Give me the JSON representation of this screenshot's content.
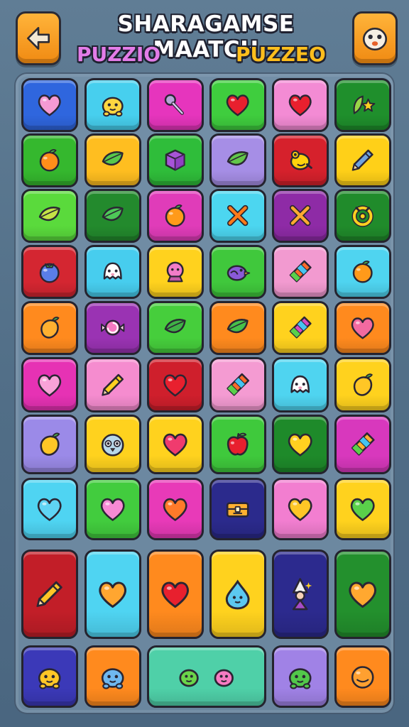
{
  "header": {
    "title": "SHARAGAMSE MAATCH",
    "subtitle_left": "PUZZIO",
    "subtitle_right": "PUZZEO",
    "back_icon": "back-arrow-icon",
    "profile_icon": "cartoon-face-icon"
  },
  "board": {
    "rows": [
      [
        {
          "color": "#2f66de",
          "icon": "heart-icon",
          "accent": "#f59ad4"
        },
        {
          "color": "#47cfee",
          "icon": "face-icon",
          "accent": "#ffd640"
        },
        {
          "color": "#e635bd",
          "icon": "wand-icon",
          "accent": "#b7a4d9"
        },
        {
          "color": "#3fcd3e",
          "icon": "heart-icon",
          "accent": "#e8202e"
        },
        {
          "color": "#f38bd4",
          "icon": "heart-icon",
          "accent": "#e8202e"
        },
        {
          "color": "#1f8f2c",
          "icon": "leaf-star-icon",
          "accent": "#9bd448"
        }
      ],
      [
        {
          "color": "#35b82e",
          "icon": "orange-icon",
          "accent": "#ff8e1a"
        },
        {
          "color": "#ffbe20",
          "icon": "leaf-icon",
          "accent": "#58c84c"
        },
        {
          "color": "#2fbd3a",
          "icon": "cube-icon",
          "accent": "#a754d8"
        },
        {
          "color": "#a68ee6",
          "icon": "leaf-icon",
          "accent": "#62c64a"
        },
        {
          "color": "#d6212c",
          "icon": "blob-creature-icon",
          "accent": "#ffd20c"
        },
        {
          "color": "#ffd018",
          "icon": "pen-icon",
          "accent": "#6fa3e0"
        }
      ],
      [
        {
          "color": "#5ada3c",
          "icon": "leaf-icon",
          "accent": "#c4e246"
        },
        {
          "color": "#238a2d",
          "icon": "leaf-icon",
          "accent": "#4ec858"
        },
        {
          "color": "#e03cb9",
          "icon": "orange-icon",
          "accent": "#ff9a1a"
        },
        {
          "color": "#4cd6f0",
          "icon": "cross-icon",
          "accent": "#ff7a1a"
        },
        {
          "color": "#8e2ba6",
          "icon": "cross-icon",
          "accent": "#ffaa30"
        },
        {
          "color": "#208b2b",
          "icon": "ring-icon",
          "accent": "#ffd020"
        }
      ],
      [
        {
          "color": "#d42631",
          "icon": "berry-icon",
          "accent": "#5a7ee8"
        },
        {
          "color": "#47cdee",
          "icon": "ghost-icon",
          "accent": "#ffffff"
        },
        {
          "color": "#ffd21e",
          "icon": "globe-creature-icon",
          "accent": "#f27cc8"
        },
        {
          "color": "#40c83c",
          "icon": "bird-icon",
          "accent": "#8a5ad8"
        },
        {
          "color": "#f29ad0",
          "icon": "crayon-icon",
          "accent": "#ff6a2a"
        },
        {
          "color": "#4fd4f0",
          "icon": "orange-icon",
          "accent": "#ff9a1a"
        }
      ],
      [
        {
          "color": "#ff8a1e",
          "icon": "mango-icon",
          "accent": "#ffb030"
        },
        {
          "color": "#9a33b3",
          "icon": "candy-icon",
          "accent": "#f77ac2"
        },
        {
          "color": "#46ce3c",
          "icon": "leaf-icon",
          "accent": "#3fb046"
        },
        {
          "color": "#ff8a1e",
          "icon": "leaf-icon",
          "accent": "#46c04a"
        },
        {
          "color": "#ffd21e",
          "icon": "crayon-icon",
          "accent": "#d64bc0"
        },
        {
          "color": "#ff8a1e",
          "icon": "heart-icon",
          "accent": "#f26aa0"
        }
      ],
      [
        {
          "color": "#e632b4",
          "icon": "heart-icon",
          "accent": "#f9a2d8"
        },
        {
          "color": "#f58ccf",
          "icon": "pen-icon",
          "accent": "#ffd020"
        },
        {
          "color": "#cf1f2c",
          "icon": "heart-icon",
          "accent": "#e8202e"
        },
        {
          "color": "#f49bd2",
          "icon": "crayon-icon",
          "accent": "#ff6a2a"
        },
        {
          "color": "#4fd4f0",
          "icon": "ghost-icon",
          "accent": "#ffffff"
        },
        {
          "color": "#ffd21e",
          "icon": "mango-icon",
          "accent": "#ffc626"
        }
      ],
      [
        {
          "color": "#9b8ae8",
          "icon": "mango-icon",
          "accent": "#ffc626"
        },
        {
          "color": "#ffd21e",
          "icon": "owl-face-icon",
          "accent": "#b8d8ea"
        },
        {
          "color": "#ffd21e",
          "icon": "heart-icon",
          "accent": "#f03b6e"
        },
        {
          "color": "#3fc93c",
          "icon": "apple-icon",
          "accent": "#e8202e"
        },
        {
          "color": "#1e8a2a",
          "icon": "heart-icon",
          "accent": "#ffd020"
        },
        {
          "color": "#d838bd",
          "icon": "crayon-icon",
          "accent": "#ffb030"
        }
      ],
      [
        {
          "color": "#4fd4f2",
          "icon": "heart-icon",
          "accent": "#5fd4f4"
        },
        {
          "color": "#42cc3e",
          "icon": "heart-icon",
          "accent": "#f78ad4"
        },
        {
          "color": "#e83ab8",
          "icon": "heart-icon",
          "accent": "#ff7a2a"
        },
        {
          "color": "#2b2a8c",
          "icon": "chest-icon",
          "accent": "#ffb030"
        },
        {
          "color": "#f27ed0",
          "icon": "heart-icon",
          "accent": "#ffc626"
        },
        {
          "color": "#ffd21e",
          "icon": "heart-icon",
          "accent": "#5ad04a"
        }
      ],
      [
        {
          "color": "#c21e28",
          "icon": "pen-icon",
          "accent": "#ffc626",
          "tall": true
        },
        {
          "color": "#4fd4f2",
          "icon": "heart-icon",
          "accent": "#ffa630",
          "tall": true
        },
        {
          "color": "#ff8a1e",
          "icon": "heart-icon",
          "accent": "#e8202e",
          "tall": true
        },
        {
          "color": "#ffd21e",
          "icon": "droplet-icon",
          "accent": "#5cc8f0",
          "tall": true
        },
        {
          "color": "#2c2a8e",
          "icon": "wizard-icon",
          "accent": "#f2f2f2",
          "tall": true
        },
        {
          "color": "#23902d",
          "icon": "heart-icon",
          "accent": "#ffa830",
          "tall": true
        }
      ],
      [
        {
          "color": "#3b39b8",
          "icon": "creature-icon",
          "accent": "#ffc626"
        },
        {
          "color": "#ff8a1e",
          "icon": "creature-icon",
          "accent": "#6fb8f0"
        },
        {
          "color": "#4fd0a8",
          "icon": "twin-creatures-icon",
          "accent": "#6ad44a",
          "wide": true
        },
        {
          "color": "#a082e6",
          "icon": "creature-icon",
          "accent": "#52c84a"
        },
        {
          "color": "#ff8a1e",
          "icon": "blob-icon",
          "accent": "#ffa030"
        }
      ]
    ]
  }
}
